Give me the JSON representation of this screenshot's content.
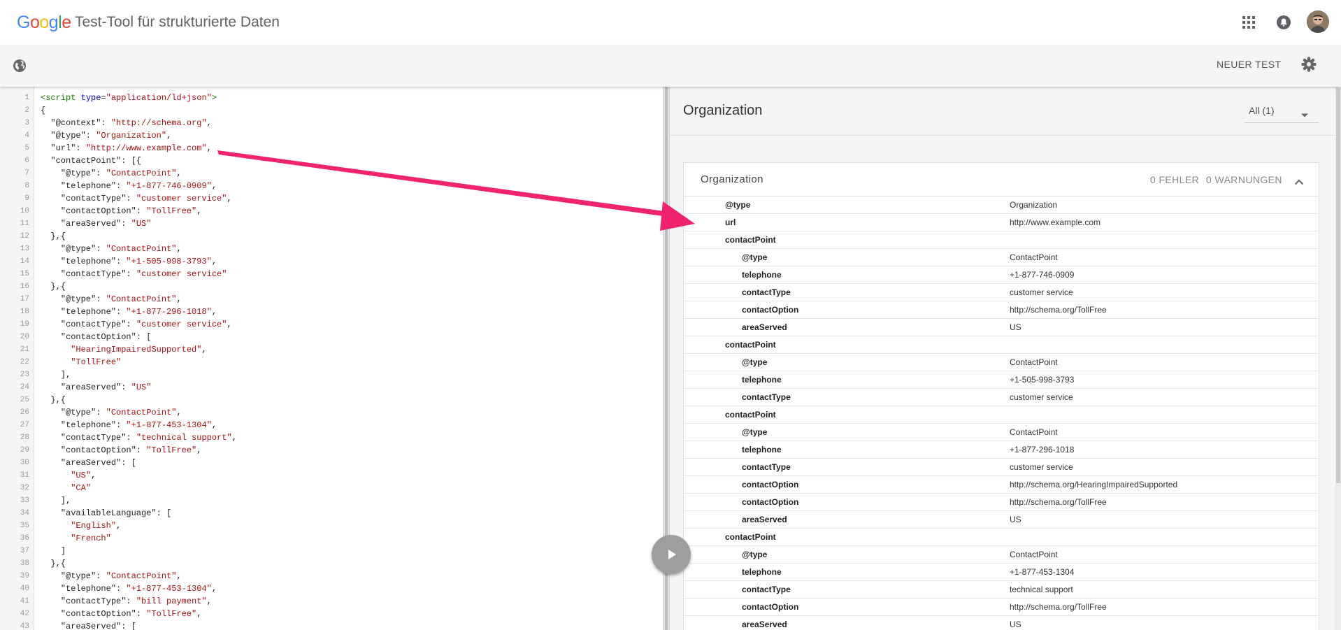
{
  "header": {
    "logo_letters": [
      {
        "ch": "G",
        "color": "#4285F4"
      },
      {
        "ch": "o",
        "color": "#EA4335"
      },
      {
        "ch": "o",
        "color": "#FBBC05"
      },
      {
        "ch": "g",
        "color": "#4285F4"
      },
      {
        "ch": "l",
        "color": "#34A853"
      },
      {
        "ch": "e",
        "color": "#EA4335"
      }
    ],
    "title": "Test-Tool für strukturierte Daten"
  },
  "toolbar": {
    "new_test_label": "NEUER TEST"
  },
  "editor": {
    "lines": [
      [
        "1",
        "<script type=\"application/ld+json\">"
      ],
      [
        "2",
        "{"
      ],
      [
        "3",
        "  \"@context\": \"http://schema.org\","
      ],
      [
        "4",
        "  \"@type\": \"Organization\","
      ],
      [
        "5",
        "  \"url\": \"http://www.example.com\","
      ],
      [
        "6",
        "  \"contactPoint\": [{"
      ],
      [
        "7",
        "    \"@type\": \"ContactPoint\","
      ],
      [
        "8",
        "    \"telephone\": \"+1-877-746-0909\","
      ],
      [
        "9",
        "    \"contactType\": \"customer service\","
      ],
      [
        "10",
        "    \"contactOption\": \"TollFree\","
      ],
      [
        "11",
        "    \"areaServed\": \"US\""
      ],
      [
        "12",
        "  },{"
      ],
      [
        "13",
        "    \"@type\": \"ContactPoint\","
      ],
      [
        "14",
        "    \"telephone\": \"+1-505-998-3793\","
      ],
      [
        "15",
        "    \"contactType\": \"customer service\""
      ],
      [
        "16",
        "  },{"
      ],
      [
        "17",
        "    \"@type\": \"ContactPoint\","
      ],
      [
        "18",
        "    \"telephone\": \"+1-877-296-1018\","
      ],
      [
        "19",
        "    \"contactType\": \"customer service\","
      ],
      [
        "20",
        "    \"contactOption\": ["
      ],
      [
        "21",
        "      \"HearingImpairedSupported\","
      ],
      [
        "22",
        "      \"TollFree\""
      ],
      [
        "23",
        "    ],"
      ],
      [
        "24",
        "    \"areaServed\": \"US\""
      ],
      [
        "25",
        "  },{"
      ],
      [
        "26",
        "    \"@type\": \"ContactPoint\","
      ],
      [
        "27",
        "    \"telephone\": \"+1-877-453-1304\","
      ],
      [
        "28",
        "    \"contactType\": \"technical support\","
      ],
      [
        "29",
        "    \"contactOption\": \"TollFree\","
      ],
      [
        "30",
        "    \"areaServed\": ["
      ],
      [
        "31",
        "      \"US\","
      ],
      [
        "32",
        "      \"CA\""
      ],
      [
        "33",
        "    ],"
      ],
      [
        "34",
        "    \"availableLanguage\": ["
      ],
      [
        "35",
        "      \"English\","
      ],
      [
        "36",
        "      \"French\""
      ],
      [
        "37",
        "    ]"
      ],
      [
        "38",
        "  },{"
      ],
      [
        "39",
        "    \"@type\": \"ContactPoint\","
      ],
      [
        "40",
        "    \"telephone\": \"+1-877-453-1304\","
      ],
      [
        "41",
        "    \"contactType\": \"bill payment\","
      ],
      [
        "42",
        "    \"contactOption\": \"TollFree\","
      ],
      [
        "43",
        "    \"areaServed\": ["
      ]
    ]
  },
  "results": {
    "title": "Organization",
    "filter_label": "All (1)",
    "card": {
      "title": "Organization",
      "errors": "0 FEHLER",
      "warnings": "0 WARNUNGEN",
      "rows": [
        {
          "level": 1,
          "key": "@type",
          "value": "Organization"
        },
        {
          "level": 1,
          "key": "url",
          "value": "http://www.example.com"
        },
        {
          "level": 1,
          "key": "contactPoint",
          "value": ""
        },
        {
          "level": 2,
          "key": "@type",
          "value": "ContactPoint"
        },
        {
          "level": 2,
          "key": "telephone",
          "value": "+1-877-746-0909"
        },
        {
          "level": 2,
          "key": "contactType",
          "value": "customer service"
        },
        {
          "level": 2,
          "key": "contactOption",
          "value": "http://schema.org/TollFree"
        },
        {
          "level": 2,
          "key": "areaServed",
          "value": "US"
        },
        {
          "level": 1,
          "key": "contactPoint",
          "value": ""
        },
        {
          "level": 2,
          "key": "@type",
          "value": "ContactPoint"
        },
        {
          "level": 2,
          "key": "telephone",
          "value": "+1-505-998-3793"
        },
        {
          "level": 2,
          "key": "contactType",
          "value": "customer service"
        },
        {
          "level": 1,
          "key": "contactPoint",
          "value": ""
        },
        {
          "level": 2,
          "key": "@type",
          "value": "ContactPoint"
        },
        {
          "level": 2,
          "key": "telephone",
          "value": "+1-877-296-1018"
        },
        {
          "level": 2,
          "key": "contactType",
          "value": "customer service"
        },
        {
          "level": 2,
          "key": "contactOption",
          "value": "http://schema.org/HearingImpairedSupported"
        },
        {
          "level": 2,
          "key": "contactOption",
          "value": "http://schema.org/TollFree"
        },
        {
          "level": 2,
          "key": "areaServed",
          "value": "US"
        },
        {
          "level": 1,
          "key": "contactPoint",
          "value": ""
        },
        {
          "level": 2,
          "key": "@type",
          "value": "ContactPoint"
        },
        {
          "level": 2,
          "key": "telephone",
          "value": "+1-877-453-1304"
        },
        {
          "level": 2,
          "key": "contactType",
          "value": "technical support"
        },
        {
          "level": 2,
          "key": "contactOption",
          "value": "http://schema.org/TollFree"
        },
        {
          "level": 2,
          "key": "areaServed",
          "value": "US"
        }
      ]
    }
  },
  "icons": {
    "apps": "apps-grid-icon",
    "notifications": "bell-icon",
    "avatar": "user-avatar",
    "globe": "globe-icon",
    "settings": "gear-icon",
    "filter": "dropdown-arrow-icon",
    "collapse": "chevron-up-icon",
    "run": "play-icon"
  },
  "colors": {
    "annotation_arrow": "#f0246c",
    "string": "#aa1111",
    "tag": "#117700",
    "attr": "#0000cc",
    "play_button": "#9e9e9e"
  }
}
